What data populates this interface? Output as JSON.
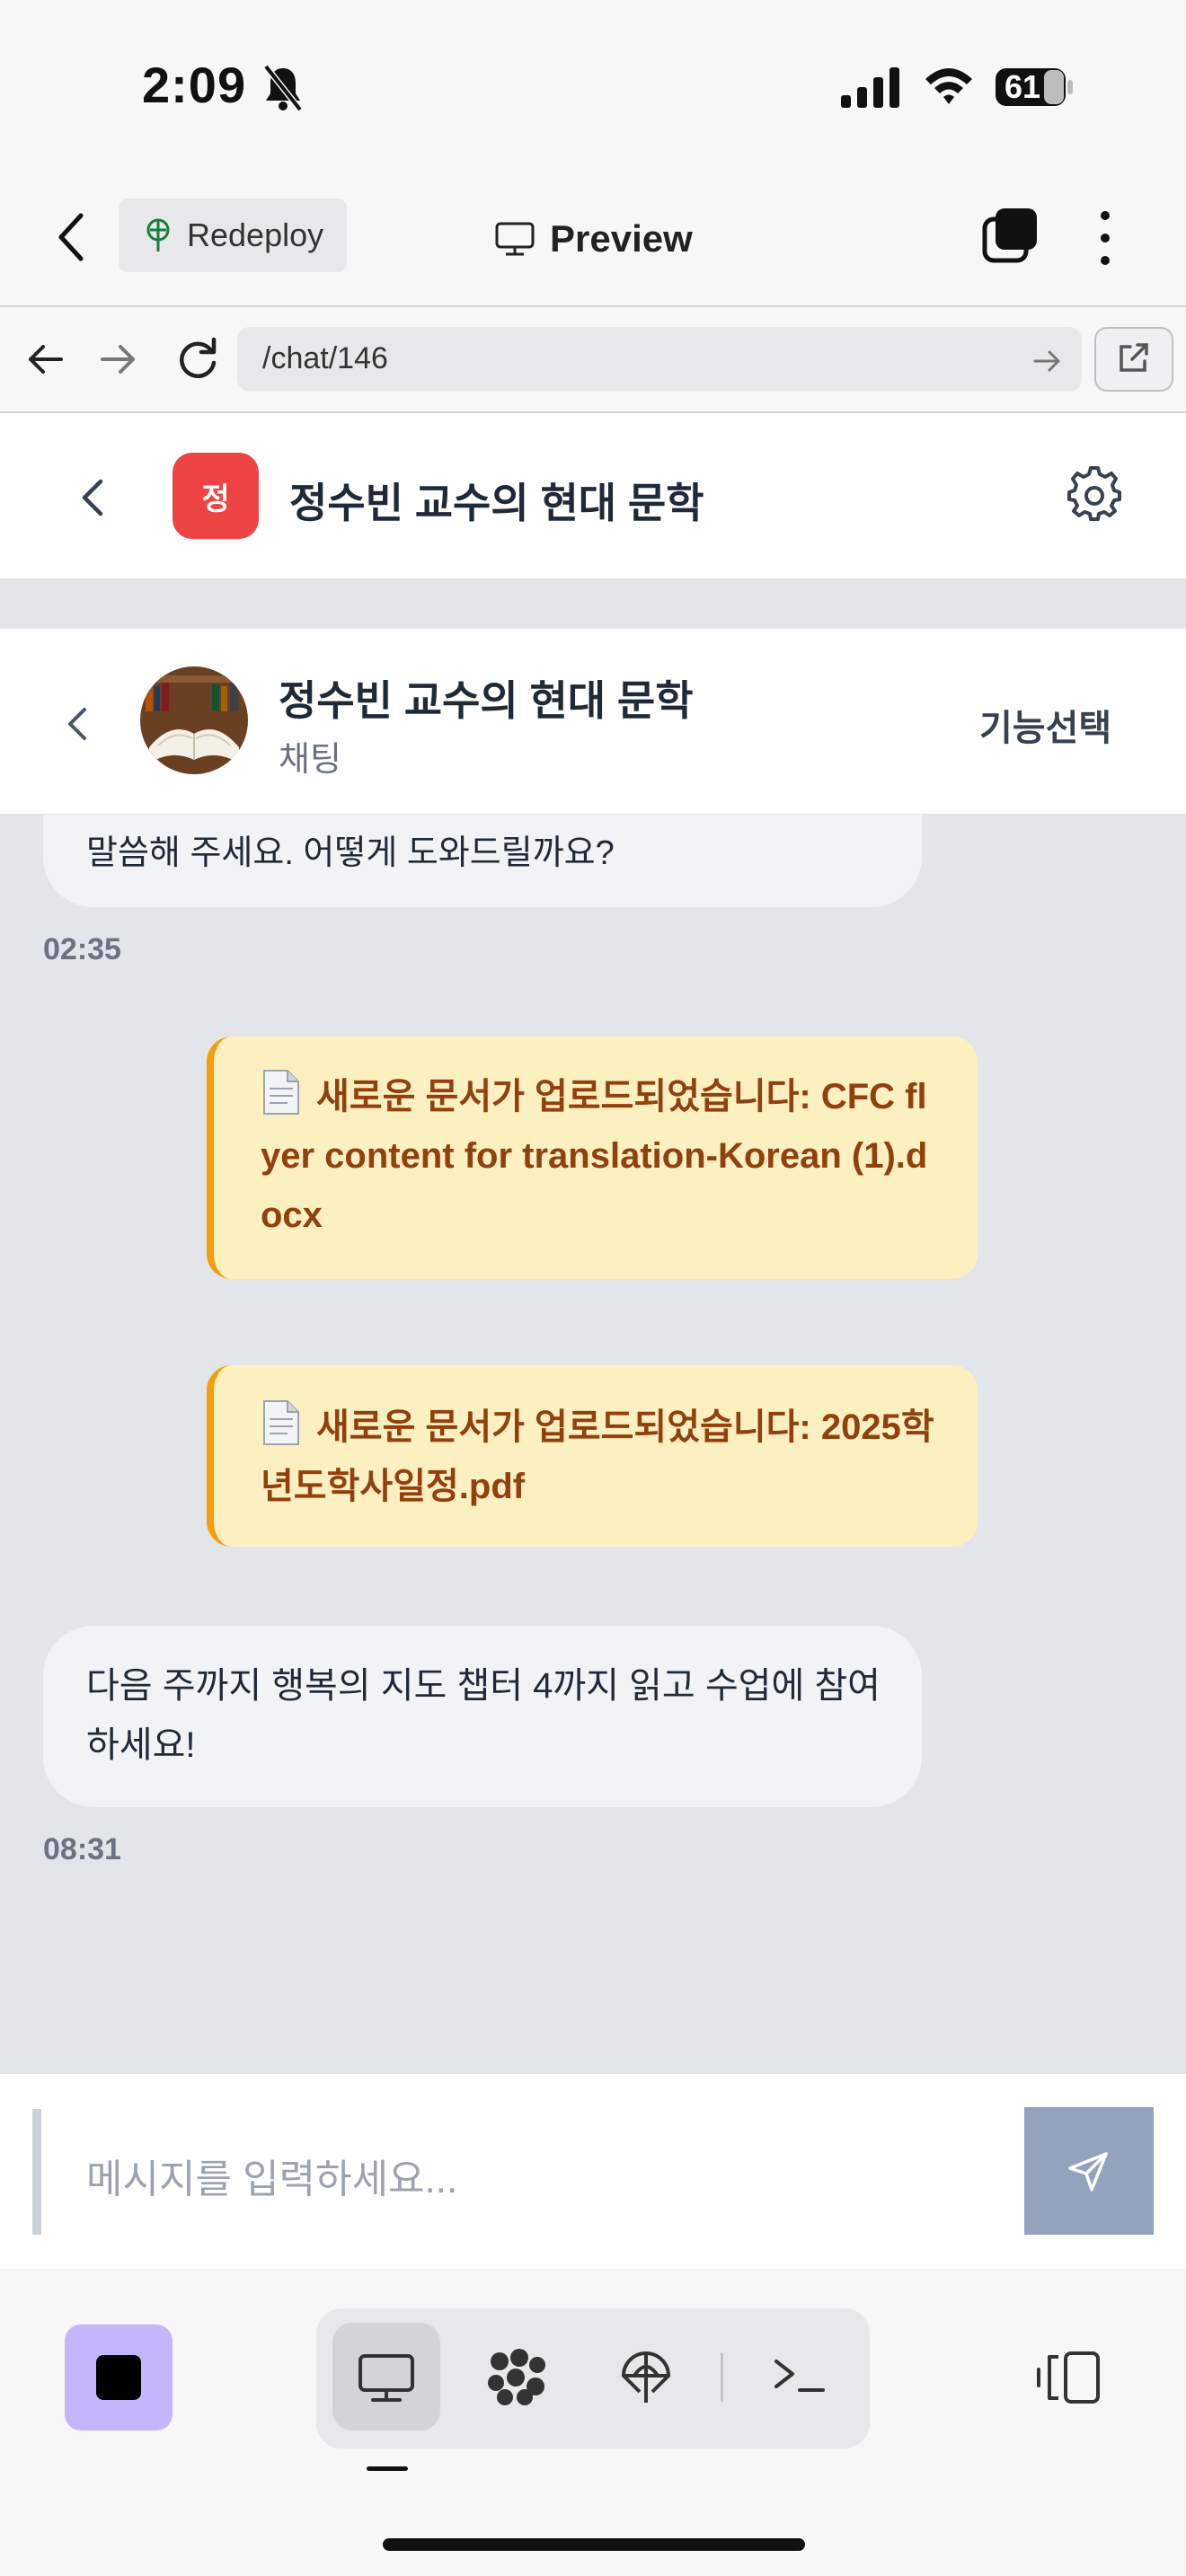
{
  "status_bar": {
    "time": "2:09",
    "battery": "61"
  },
  "replit_bar": {
    "redeploy_label": "Redeploy",
    "preview_label": "Preview"
  },
  "browser": {
    "url": "/chat/146"
  },
  "app_header": {
    "avatar_letter": "정",
    "title": "정수빈 교수의 현대 문학"
  },
  "chat_header": {
    "title": "정수빈 교수의 현대 문학",
    "subtitle": "채팅",
    "feature_select": "기능선택"
  },
  "messages": {
    "partial_text": "말씀해 주세요. 어떻게 도와드릴까요?",
    "partial_time": "02:35",
    "doc1": "새로운 문서가 업로드되었습니다: CFC flyer content for translation-Korean (1).docx",
    "doc2": "새로운 문서가 업로드되었습니다: 2025학년도학사일정.pdf",
    "announce_text": "다음 주까지 행복의 지도 챕터 4까지 읽고 수업에 참여하세요!",
    "announce_time": "08:31"
  },
  "input": {
    "placeholder": "메시지를 입력하세요..."
  },
  "colors": {
    "accent_red": "#ef4444",
    "doc_bg": "#fdf0c0",
    "doc_border": "#f59e0b",
    "doc_text": "#92400e",
    "send_btn": "#94a3bd",
    "stop_btn": "#c4b5fd"
  }
}
